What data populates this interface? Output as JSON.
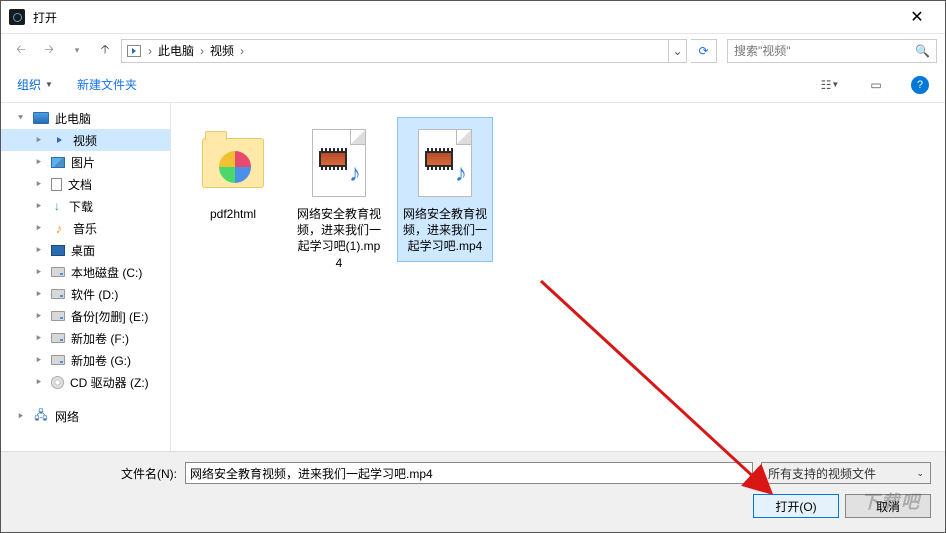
{
  "window": {
    "title": "打开"
  },
  "breadcrumb": {
    "root": "此电脑",
    "current": "视频"
  },
  "search": {
    "placeholder": "搜索\"视频\""
  },
  "toolbar": {
    "organize": "组织",
    "new_folder": "新建文件夹"
  },
  "sidebar": {
    "this_pc": "此电脑",
    "videos": "视频",
    "pictures": "图片",
    "documents": "文档",
    "downloads": "下载",
    "music": "音乐",
    "desktop": "桌面",
    "drive_c": "本地磁盘 (C:)",
    "drive_d": "软件 (D:)",
    "drive_e": "备份[勿删] (E:)",
    "drive_f": "新加卷 (F:)",
    "drive_g": "新加卷 (G:)",
    "drive_z": "CD 驱动器 (Z:)",
    "network": "网络"
  },
  "files": {
    "f0": "pdf2html",
    "f1": "网络安全教育视频，进来我们一起学习吧(1).mp4",
    "f2": "网络安全教育视频，进来我们一起学习吧.mp4"
  },
  "footer": {
    "filename_label": "文件名(N):",
    "filename_value": "网络安全教育视频，进来我们一起学习吧.mp4",
    "filter": "所有支持的视频文件",
    "open": "打开(O)",
    "cancel": "取消"
  },
  "watermark": "下载吧"
}
